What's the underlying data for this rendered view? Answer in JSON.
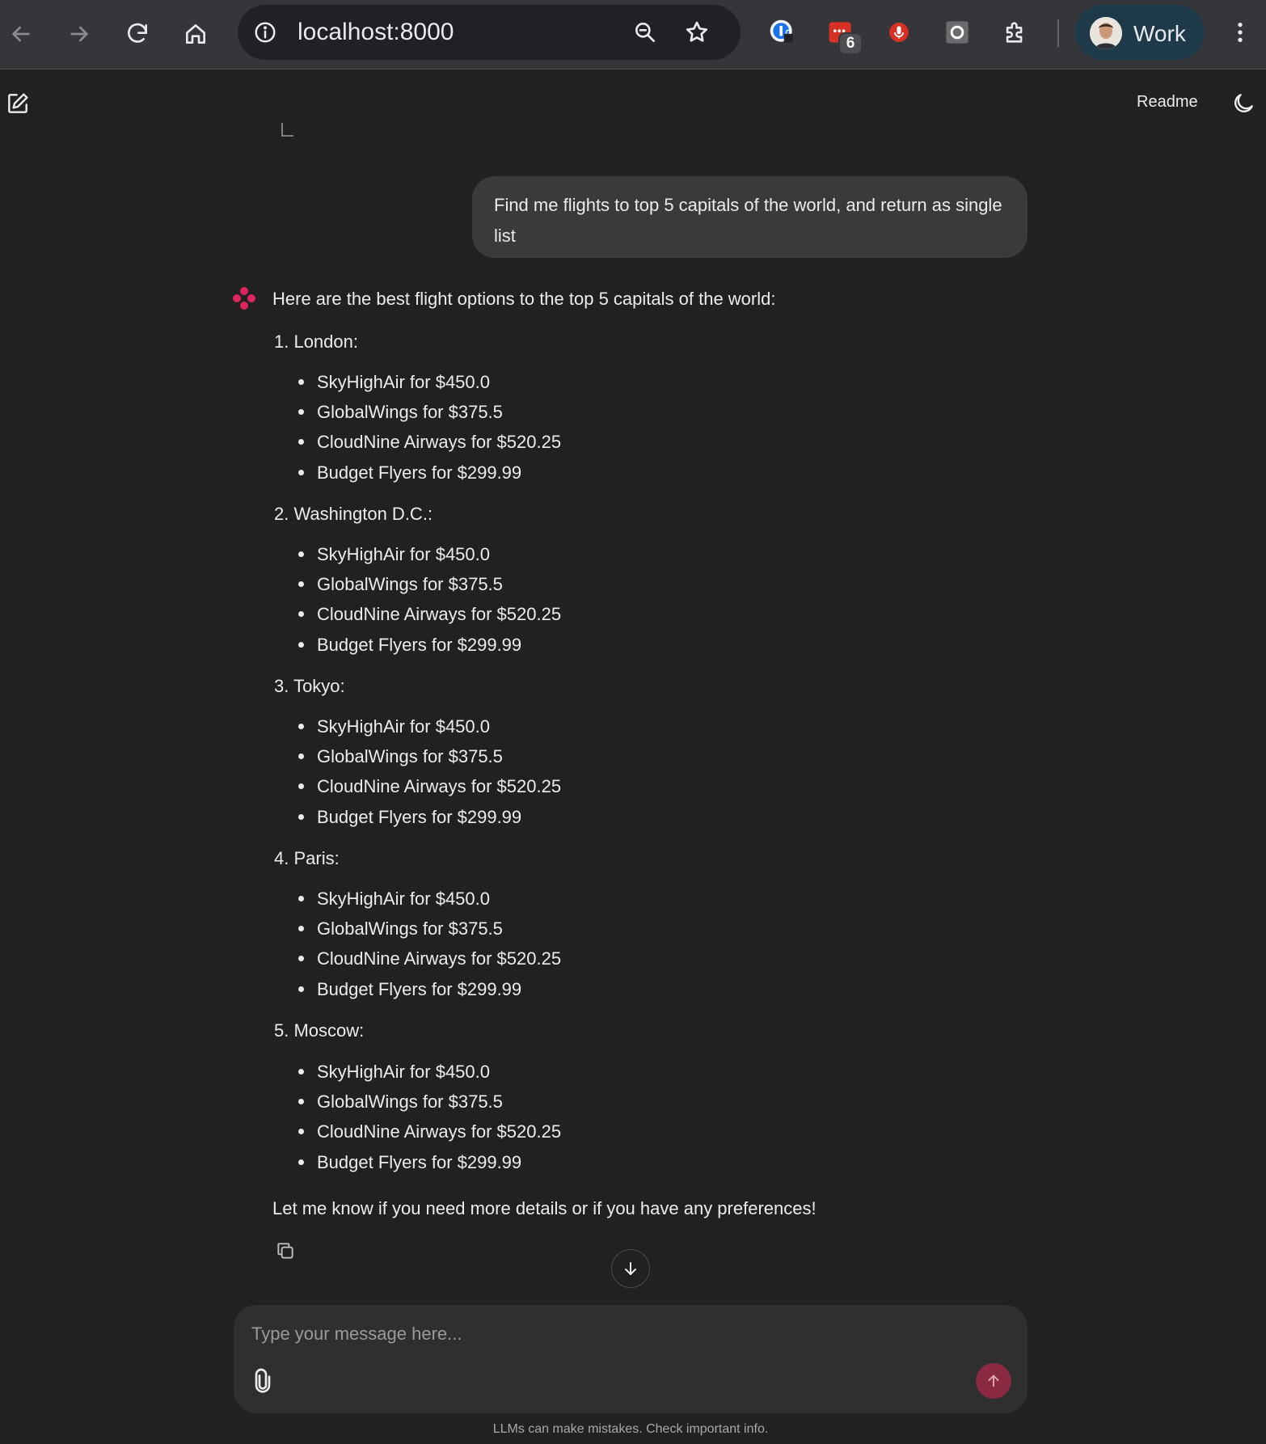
{
  "browser": {
    "url": "localhost:8000",
    "profile_label": "Work",
    "extension_badge": "6"
  },
  "header": {
    "readme_label": "Readme"
  },
  "user_message": {
    "text": "Find me  flights to top 5 capitals of the world, and return as single list"
  },
  "assistant": {
    "intro": "Here are the best flight options to the top 5 capitals of the world:",
    "cities": [
      {
        "heading": "1. London:",
        "flights": [
          "SkyHighAir for $450.0",
          "GlobalWings for $375.5",
          "CloudNine Airways for $520.25",
          "Budget Flyers for $299.99"
        ]
      },
      {
        "heading": "2. Washington D.C.:",
        "flights": [
          "SkyHighAir for $450.0",
          "GlobalWings for $375.5",
          "CloudNine Airways for $520.25",
          "Budget Flyers for $299.99"
        ]
      },
      {
        "heading": "3. Tokyo:",
        "flights": [
          "SkyHighAir for $450.0",
          "GlobalWings for $375.5",
          "CloudNine Airways for $520.25",
          "Budget Flyers for $299.99"
        ]
      },
      {
        "heading": "4. Paris:",
        "flights": [
          "SkyHighAir for $450.0",
          "GlobalWings for $375.5",
          "CloudNine Airways for $520.25",
          "Budget Flyers for $299.99"
        ]
      },
      {
        "heading": "5. Moscow:",
        "flights": [
          "SkyHighAir for $450.0",
          "GlobalWings for $375.5",
          "CloudNine Airways for $520.25",
          "Budget Flyers for $299.99"
        ]
      }
    ],
    "outro": "Let me know if you need more details or if you have any preferences!"
  },
  "composer": {
    "placeholder": "Type your message here..."
  },
  "footer": {
    "disclaimer": "LLMs can make mistakes. Check important info."
  },
  "colors": {
    "background": "#212121",
    "bubble": "#3a3a3a",
    "composer": "#2f2f2f",
    "accent": "#e0245e",
    "send_button": "#8a2942"
  }
}
